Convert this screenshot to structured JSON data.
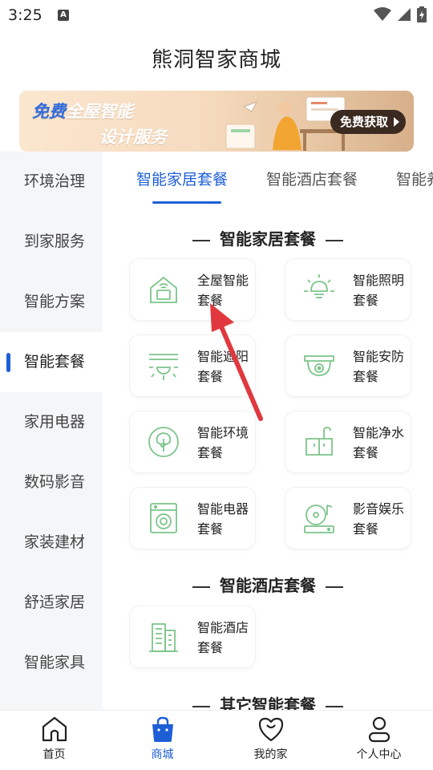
{
  "status_bar": {
    "time": "3:25",
    "notification_icon": "a-badge-icon",
    "icons": [
      "wifi-icon",
      "signal-icon",
      "battery-icon"
    ]
  },
  "page": {
    "title": "熊洞智家商城"
  },
  "banner": {
    "line1_highlight": "免费",
    "line1_rest": "全屋智能",
    "line2": "设计服务",
    "button_label": "免费获取"
  },
  "sidebar": {
    "items": [
      {
        "label": "环境治理"
      },
      {
        "label": "到家服务"
      },
      {
        "label": "智能方案"
      },
      {
        "label": "智能套餐",
        "active": true
      },
      {
        "label": "家用电器"
      },
      {
        "label": "数码影音"
      },
      {
        "label": "家装建材"
      },
      {
        "label": "舒适家居"
      },
      {
        "label": "智能家具"
      }
    ]
  },
  "tabs": [
    {
      "label": "智能家居套餐",
      "active": true
    },
    {
      "label": "智能酒店套餐"
    },
    {
      "label": "智能养"
    }
  ],
  "sections": [
    {
      "title": "智能家居套餐",
      "cards": [
        {
          "line1": "全屋智能",
          "line2": "套餐",
          "icon": "smart-home-icon"
        },
        {
          "line1": "智能照明",
          "line2": "套餐",
          "icon": "bulb-icon"
        },
        {
          "line1": "智能遮阳",
          "line2": "套餐",
          "icon": "sunshade-icon"
        },
        {
          "line1": "智能安防",
          "line2": "套餐",
          "icon": "camera-icon"
        },
        {
          "line1": "智能环境",
          "line2": "套餐",
          "icon": "tree-icon"
        },
        {
          "line1": "智能净水",
          "line2": "套餐",
          "icon": "sink-icon"
        },
        {
          "line1": "智能电器",
          "line2": "套餐",
          "icon": "washer-icon"
        },
        {
          "line1": "影音娱乐",
          "line2": "套餐",
          "icon": "music-icon"
        }
      ]
    },
    {
      "title": "智能酒店套餐",
      "cards": [
        {
          "line1": "智能酒店",
          "line2": "套餐",
          "icon": "hotel-icon"
        }
      ]
    },
    {
      "title": "其它智能套餐",
      "cards": []
    }
  ],
  "bottom_nav": [
    {
      "label": "首页",
      "icon": "home-icon"
    },
    {
      "label": "商城",
      "icon": "shopping-bag-icon",
      "active": true
    },
    {
      "label": "我的家",
      "icon": "heart-icon"
    },
    {
      "label": "个人中心",
      "icon": "person-icon"
    }
  ],
  "colors": {
    "accent": "#1e5fd6",
    "icon_green": "#7cc48a",
    "arrow": "#e0383e"
  }
}
